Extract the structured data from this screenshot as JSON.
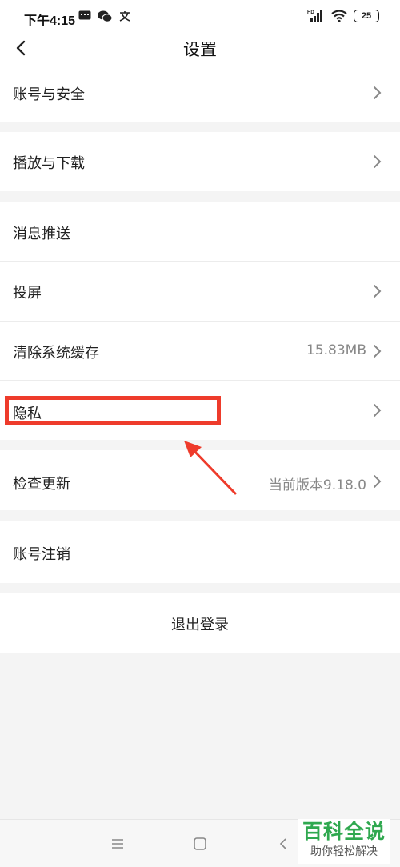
{
  "status_bar": {
    "time": "下午4:15",
    "icons_left": [
      "message-icon",
      "wechat-icon",
      "translate-icon"
    ],
    "icons_right": [
      "hd-signal-icon",
      "wifi-icon",
      "battery-icon"
    ],
    "battery": "25"
  },
  "header": {
    "title": "设置",
    "back_icon": "chevron-left-icon"
  },
  "settings": {
    "account_security": "账号与安全",
    "play_download": "播放与下载",
    "push_notifications": "消息推送",
    "screen_cast": "投屏",
    "clear_cache": {
      "label": "清除系统缓存",
      "value": "15.83MB"
    },
    "privacy": "隐私",
    "check_update": {
      "label": "检查更新",
      "value": "当前版本9.18.0"
    },
    "cancel_account": "账号注销",
    "logout": "退出登录"
  },
  "annotation": {
    "highlight_color": "#ee3b2b",
    "arrow_color": "#ee3b2b"
  },
  "nav_bar": {
    "icons": [
      "menu-icon",
      "home-icon",
      "back-icon"
    ]
  },
  "watermark": {
    "title": "百科全说",
    "subtitle": "助你轻松解决",
    "color": "#2fa84f"
  }
}
